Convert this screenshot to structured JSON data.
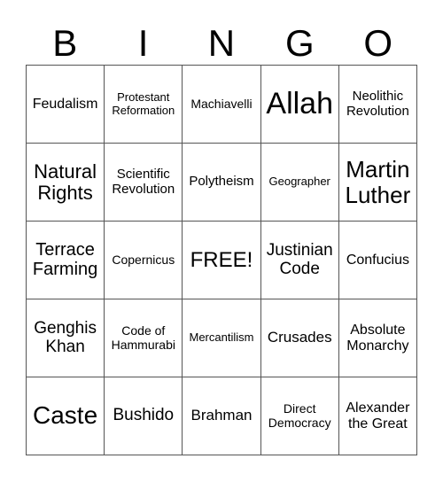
{
  "header": {
    "letters": [
      "B",
      "I",
      "N",
      "G",
      "O"
    ]
  },
  "cells": [
    [
      "Feudalism",
      "Protestant\nReformation",
      "Machiavelli",
      "Allah",
      "Neolithic\nRevolution"
    ],
    [
      "Natural\nRights",
      "Scientific\nRevolution",
      "Polytheism",
      "Geographer",
      "Martin\nLuther"
    ],
    [
      "Terrace\nFarming",
      "Copernicus",
      "FREE!",
      "Justinian\nCode",
      "Confucius"
    ],
    [
      "Genghis\nKhan",
      "Code of\nHammurabi",
      "Mercantilism",
      "Crusades",
      "Absolute\nMonarchy"
    ],
    [
      "Caste",
      "Bushido",
      "Brahman",
      "Direct\nDemocracy",
      "Alexander\nthe Great"
    ]
  ]
}
